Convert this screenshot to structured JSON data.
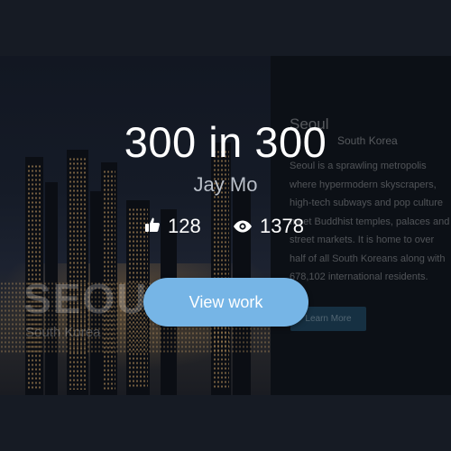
{
  "background": {
    "city_word": "SEOUL",
    "city_country": "South Korea",
    "panel": {
      "title": "Seoul",
      "subtitle": "South Korea",
      "description": "Seoul is a sprawling metropolis where hypermodern skyscrapers, high-tech subways and pop culture meet Buddhist temples, palaces and street markets. It is home to over half of all South Koreans along with 678,102 international residents.",
      "button_label": "Learn More"
    }
  },
  "card": {
    "title": "300 in 300",
    "author": "Jay Mo",
    "likes": "128",
    "views": "1378",
    "cta_label": "View work"
  },
  "icons": {
    "likes": "thumbs-up-icon",
    "views": "eye-icon"
  },
  "colors": {
    "accent": "#76b5e6",
    "text": "#ffffff",
    "muted": "#b9bfc8",
    "backdrop": "#161b24"
  }
}
